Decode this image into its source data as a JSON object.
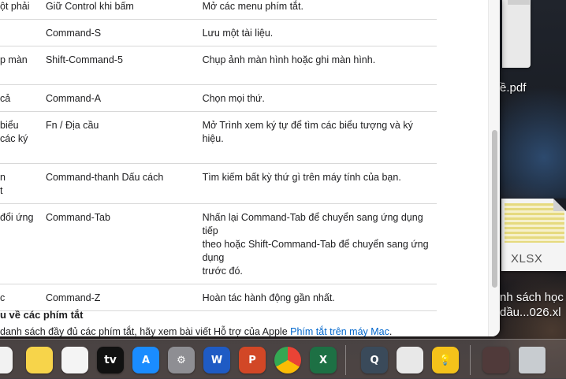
{
  "shortcuts": [
    {
      "name": "ột phải",
      "keys": "Giữ Control khi bấm",
      "desc": [
        "Mở các menu phím tắt."
      ]
    },
    {
      "name": "",
      "keys": "Command-S",
      "desc": [
        "Lưu một tài liệu."
      ]
    },
    {
      "name": "p màn",
      "keys": "Shift-Command-5",
      "desc": [
        "Chụp ảnh màn hình hoặc ghi màn hình."
      ]
    },
    {
      "name": "cả",
      "keys": "Command-A",
      "desc": [
        "Chọn mọi thứ."
      ]
    },
    {
      "name": "biểu\ncác ký",
      "keys": "Fn / Địa cầu",
      "desc": [
        "Mở Trình xem ký tự để tìm các biểu tượng và ký hiệu."
      ]
    },
    {
      "name": "n\nt",
      "keys": "Command-thanh Dấu cách",
      "desc": [
        "Tìm kiếm bất kỳ thứ gì trên máy tính của bạn."
      ]
    },
    {
      "name": "đổi ứng",
      "keys": "Command-Tab",
      "desc": [
        "Nhấn lại Command-Tab để chuyển sang ứng dụng tiếp",
        "theo hoặc Shift-Command-Tab để chuyển sang ứng dụng",
        "trước đó."
      ]
    },
    {
      "name": "c",
      "keys": "Command-Z",
      "desc": [
        "Hoàn tác hành động gần nhất."
      ]
    }
  ],
  "section": {
    "title": "u về các phím tắt",
    "text": "danh sách đầy đủ các phím tắt, hãy xem bài viết Hỗ trợ của Apple ",
    "link": "Phím tắt trên máy Mac",
    "end": "."
  },
  "desktop": {
    "pdf_label": "ề.pdf",
    "xlsx_thumb_label": "XLSX",
    "xlsx_name_line1": "nh sách học",
    "xlsx_name_line2": "dầu...026.xl"
  },
  "dock": {
    "items": [
      {
        "name": "reminders-icon",
        "color": "#f2f2f2",
        "text": ""
      },
      {
        "name": "notes-icon",
        "color": "#f7d44a",
        "text": ""
      },
      {
        "name": "freeform-icon",
        "color": "#f4f4f4",
        "text": ""
      },
      {
        "name": "apple-tv-icon",
        "color": "#111111",
        "text": "tv"
      },
      {
        "name": "app-store-icon",
        "color": "#1a8cff",
        "text": "A"
      },
      {
        "name": "system-settings-icon",
        "color": "#8e8e93",
        "text": "⚙"
      },
      {
        "name": "word-icon",
        "color": "#1f5bc4",
        "text": "W"
      },
      {
        "name": "powerpoint-icon",
        "color": "#d24726",
        "text": "P"
      },
      {
        "name": "chrome-icon",
        "color": "#ffffff",
        "text": ""
      },
      {
        "name": "excel-icon",
        "color": "#1d7044",
        "text": "X"
      },
      {
        "name": "quicktime-icon",
        "color": "#3a4a5a",
        "text": "Q"
      },
      {
        "name": "archive-utility-icon",
        "color": "#e8e8e8",
        "text": ""
      },
      {
        "name": "tips-icon",
        "color": "#f4c21a",
        "text": "💡"
      },
      {
        "name": "photo-booth-icon",
        "color": "#503a3a",
        "text": ""
      },
      {
        "name": "trash-icon",
        "color": "#c8ccd0",
        "text": ""
      }
    ]
  }
}
